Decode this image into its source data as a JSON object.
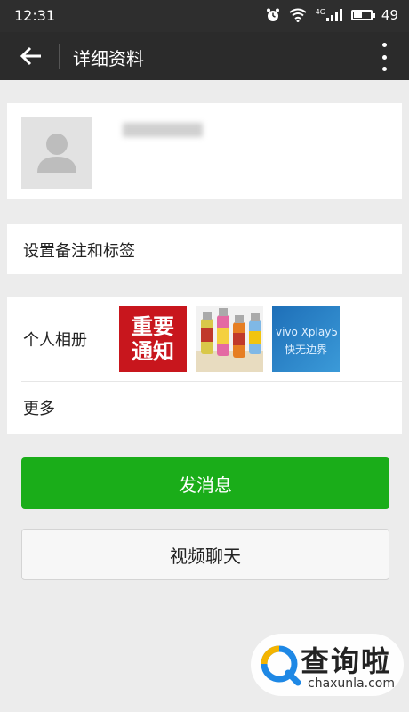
{
  "status_bar": {
    "time": "12:31",
    "battery": "49",
    "battery_level": 0.49,
    "network": "4G",
    "icons": [
      "alarm-icon",
      "wifi-icon",
      "signal-icon",
      "battery-icon"
    ]
  },
  "header": {
    "title": "详细资料",
    "back_icon": "arrow-left-icon",
    "more_icon": "more-vertical-icon",
    "background": "#2b2b2b"
  },
  "profile": {
    "avatar_icon": "default-avatar-icon",
    "nickname": "(blurred)"
  },
  "remark": {
    "label": "设置备注和标签"
  },
  "album": {
    "label": "个人相册",
    "thumbs": [
      {
        "text_line1": "重要",
        "text_line2": "通知"
      },
      {
        "description_icon": "bottles-photo"
      },
      {
        "text_line1": "vivo Xplay5",
        "text_line2": "快无边界"
      }
    ]
  },
  "more": {
    "label": "更多"
  },
  "buttons": {
    "send_message": "发消息",
    "video_chat": "视频聊天",
    "primary_color": "#1aad19"
  },
  "watermark": {
    "text_cn": "查询啦",
    "text_en": "chaxunla.com"
  }
}
